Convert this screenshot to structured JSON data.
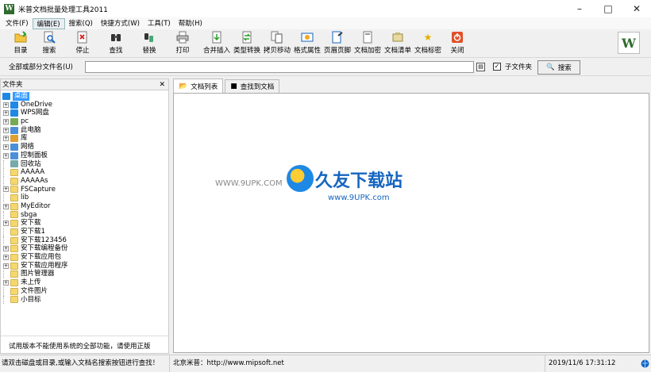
{
  "window": {
    "title": "米普文档批量处理工具2011"
  },
  "menu": [
    "文件(F)",
    "编辑(E)",
    "搜索(Q)",
    "快捷方式(W)",
    "工具(T)",
    "帮助(H)"
  ],
  "toolbar": [
    {
      "label": "目录",
      "icon": "folder-open-icon"
    },
    {
      "label": "搜索",
      "icon": "search-icon"
    },
    {
      "label": "停止",
      "icon": "stop-icon"
    },
    {
      "label": "查找",
      "icon": "binoculars-icon"
    },
    {
      "label": "替换",
      "icon": "replace-icon"
    },
    {
      "label": "打印",
      "icon": "printer-icon"
    },
    {
      "label": "合并插入",
      "icon": "merge-icon"
    },
    {
      "label": "类型转换",
      "icon": "convert-icon"
    },
    {
      "label": "拷贝移动",
      "icon": "copy-move-icon"
    },
    {
      "label": "格式属性",
      "icon": "format-icon"
    },
    {
      "label": "页眉页脚",
      "icon": "header-footer-icon"
    },
    {
      "label": "文档加密",
      "icon": "encrypt-icon"
    },
    {
      "label": "文档清单",
      "icon": "list-icon"
    },
    {
      "label": "文档标密",
      "icon": "star-icon"
    },
    {
      "label": "关闭",
      "icon": "power-icon"
    }
  ],
  "search": {
    "label": "全部或部分文件名(U)",
    "value": "",
    "subfolder_label": "子文件夹",
    "subfolder_checked": "✓",
    "button_label": "搜索"
  },
  "folder_panel": {
    "title": "文件夹",
    "items": [
      {
        "label": "桌面",
        "level": 0,
        "expandable": false,
        "icon": "desktop"
      },
      {
        "label": "OneDrive",
        "level": 1,
        "expandable": true,
        "icon": "cloud"
      },
      {
        "label": "WPS网盘",
        "level": 1,
        "expandable": true,
        "icon": "cloud"
      },
      {
        "label": "pc",
        "level": 1,
        "expandable": true,
        "icon": "user"
      },
      {
        "label": "此电脑",
        "level": 1,
        "expandable": true,
        "icon": "computer"
      },
      {
        "label": "库",
        "level": 1,
        "expandable": true,
        "icon": "library"
      },
      {
        "label": "网络",
        "level": 1,
        "expandable": true,
        "icon": "network"
      },
      {
        "label": "控制面板",
        "level": 1,
        "expandable": true,
        "icon": "control"
      },
      {
        "label": "回收站",
        "level": 1,
        "expandable": false,
        "icon": "recycle"
      },
      {
        "label": "AAAAA",
        "level": 1,
        "expandable": false,
        "icon": "folder"
      },
      {
        "label": "AAAAAs",
        "level": 1,
        "expandable": false,
        "icon": "folder"
      },
      {
        "label": "FSCapture",
        "level": 1,
        "expandable": true,
        "icon": "folder"
      },
      {
        "label": "lib",
        "level": 1,
        "expandable": false,
        "icon": "folder"
      },
      {
        "label": "MyEditor",
        "level": 1,
        "expandable": true,
        "icon": "folder"
      },
      {
        "label": "sbga",
        "level": 1,
        "expandable": false,
        "icon": "folder"
      },
      {
        "label": "安下载",
        "level": 1,
        "expandable": true,
        "icon": "folder"
      },
      {
        "label": "安下载1",
        "level": 1,
        "expandable": false,
        "icon": "folder"
      },
      {
        "label": "安下载123456",
        "level": 1,
        "expandable": false,
        "icon": "folder"
      },
      {
        "label": "安下载编程备份",
        "level": 1,
        "expandable": true,
        "icon": "folder"
      },
      {
        "label": "安下载应用包",
        "level": 1,
        "expandable": true,
        "icon": "folder-special"
      },
      {
        "label": "安下载应用程序",
        "level": 1,
        "expandable": true,
        "icon": "folder"
      },
      {
        "label": "图片管理器",
        "level": 1,
        "expandable": false,
        "icon": "folder"
      },
      {
        "label": "未上传",
        "level": 1,
        "expandable": true,
        "icon": "folder"
      },
      {
        "label": "文件图片",
        "level": 1,
        "expandable": false,
        "icon": "folder"
      },
      {
        "label": "小目标",
        "level": 1,
        "expandable": false,
        "icon": "folder"
      }
    ],
    "footer": "试用版本不能使用系统的全部功能，请使用正版"
  },
  "tabs": [
    {
      "label": "文档列表",
      "active": true,
      "icon": "folder-open-icon"
    },
    {
      "label": "查找到文档",
      "active": false,
      "icon": "binoculars-icon"
    }
  ],
  "watermark": {
    "title": "久友下载站",
    "url_left": "WWW.9UPK.COM",
    "url": "www.9UPK.com"
  },
  "status": {
    "hint": "请双击磁盘或目录,或输入文档名搜索按钮进行查找！",
    "company": "北京米普：http://www.mipsoft.net",
    "datetime": "2019/11/6 17:31:12"
  }
}
